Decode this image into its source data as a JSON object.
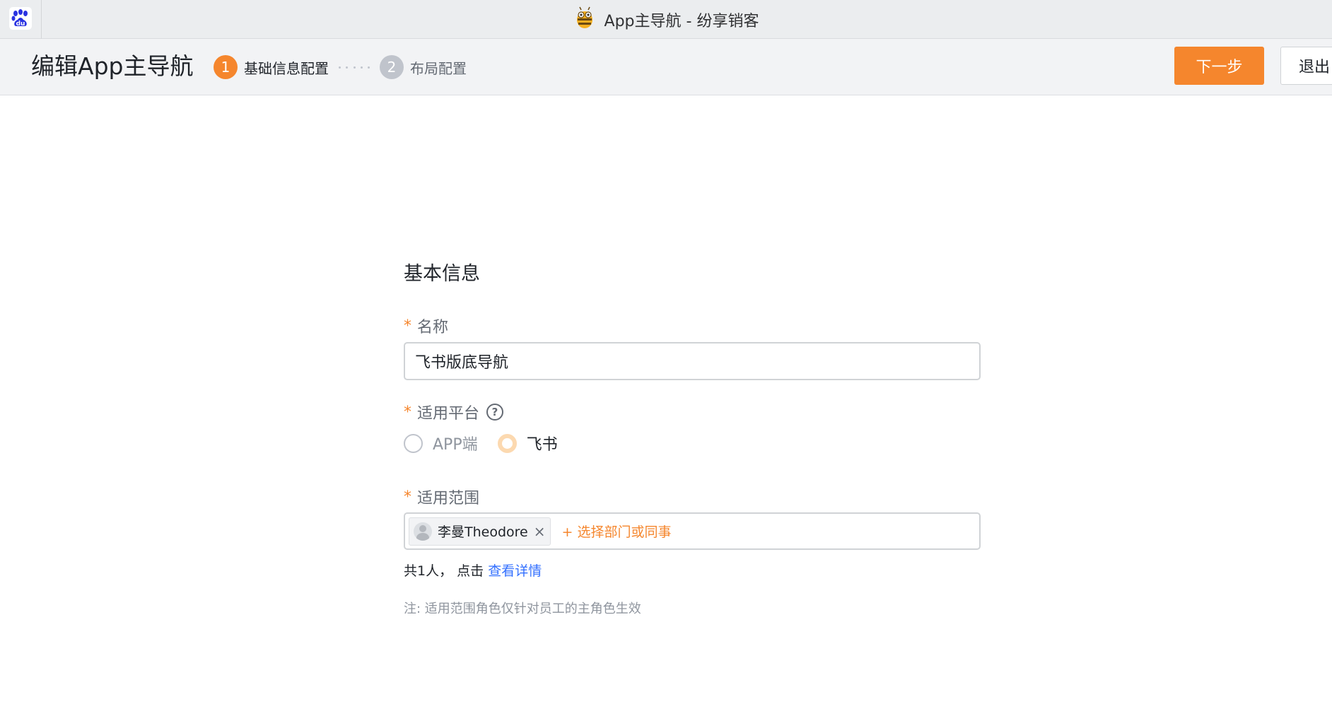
{
  "window": {
    "title": "App主导航 - 纷享销客",
    "browser_icon": "baidu-paw-icon",
    "app_icon": "fxiaoke-bee-icon"
  },
  "header": {
    "page_title": "编辑App主导航",
    "steps": [
      {
        "number": "1",
        "label": "基础信息配置",
        "state": "active"
      },
      {
        "number": "2",
        "label": "布局配置",
        "state": "inactive"
      }
    ],
    "next_button": "下一步",
    "exit_button": "退出"
  },
  "form": {
    "section_title": "基本信息",
    "name": {
      "required_mark": "*",
      "label": "名称",
      "value": "飞书版底导航"
    },
    "platform": {
      "required_mark": "*",
      "label": "适用平台",
      "help_icon": "question-circle-icon",
      "options": [
        {
          "label": "APP端",
          "checked": false
        },
        {
          "label": "飞书",
          "checked": true
        }
      ]
    },
    "scope": {
      "required_mark": "*",
      "label": "适用范围",
      "tags": [
        {
          "label": "李曼Theodore",
          "avatar": "user-avatar-icon"
        }
      ],
      "add_link": "+ 选择部门或同事",
      "count_text": "共1人， 点击",
      "detail_link": "查看详情",
      "note": "注: 适用范围角色仅针对员工的主角色生效"
    }
  },
  "colors": {
    "accent": "#f5862d",
    "link": "#3370ff"
  }
}
